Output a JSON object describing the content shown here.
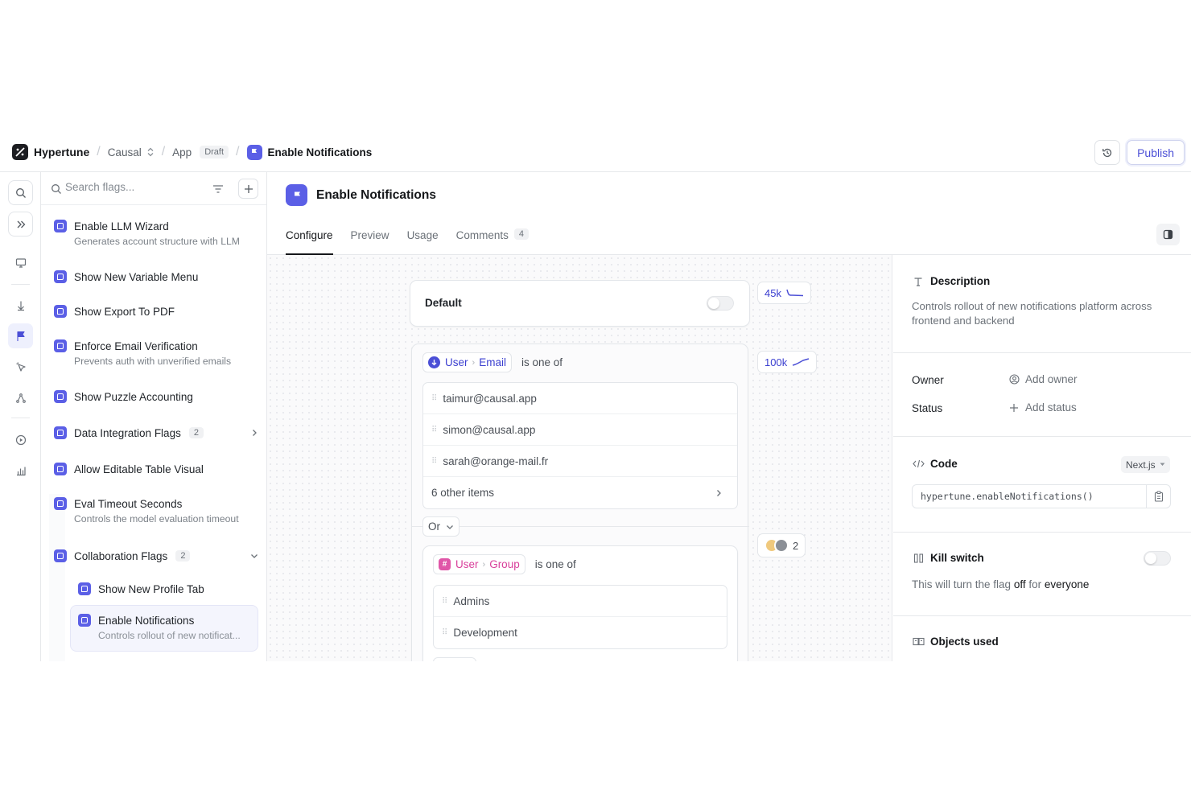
{
  "header": {
    "brand": "Hypertune",
    "project": "Causal",
    "app": "App",
    "app_status": "Draft",
    "flag_title": "Enable Notifications",
    "publish_label": "Publish"
  },
  "sidebar": {
    "search_placeholder": "Search flags...",
    "items": [
      {
        "title": "Enable LLM Wizard",
        "desc": "Generates account structure with LLM"
      },
      {
        "title": "Show New Variable Menu"
      },
      {
        "title": "Show Export To PDF"
      },
      {
        "title": "Enforce Email Verification",
        "desc": "Prevents auth with unverified emails"
      },
      {
        "title": "Show Puzzle Accounting"
      },
      {
        "title": "Data Integration Flags",
        "count": "2"
      },
      {
        "title": "Allow Editable Table Visual"
      },
      {
        "title": "Eval Timeout Seconds",
        "desc": "Controls the model evaluation timeout"
      },
      {
        "title": "Collaboration Flags",
        "count": "2"
      },
      {
        "title": "Show New Profile Tab"
      },
      {
        "title": "Enable Notifications",
        "desc": "Controls rollout of new notificat..."
      }
    ]
  },
  "main": {
    "title": "Enable Notifications",
    "tabs": [
      {
        "label": "Configure",
        "active": true
      },
      {
        "label": "Preview"
      },
      {
        "label": "Usage"
      },
      {
        "label": "Comments",
        "count": "4"
      }
    ]
  },
  "canvas": {
    "default_label": "Default",
    "default_count": "45k",
    "rule1": {
      "chip_a": "User",
      "chip_b": "Email",
      "operator": "is one of",
      "count": "100k",
      "items": [
        "taimur@causal.app",
        "simon@causal.app",
        "sarah@orange-mail.fr"
      ],
      "more": "6 other items"
    },
    "or_label": "Or",
    "rule2": {
      "chip_a": "User",
      "chip_b": "Group",
      "operator": "is one of",
      "avatar_count": "2",
      "items": [
        "Admins",
        "Development"
      ]
    }
  },
  "details": {
    "description_title": "Description",
    "description_text": "Controls rollout of new notifications platform across frontend and backend",
    "owner_label": "Owner",
    "owner_action": "Add owner",
    "status_label": "Status",
    "status_action": "Add status",
    "code_title": "Code",
    "code_framework": "Next.js",
    "code_snippet": "hypertune.enableNotifications()",
    "kill_title": "Kill switch",
    "kill_text_a": "This will turn the flag ",
    "kill_text_b": "off",
    "kill_text_c": " for ",
    "kill_text_d": "everyone",
    "objects_title": "Objects used"
  },
  "colors": {
    "accent": "#5b5fe6",
    "link": "#3b3fd0",
    "group": "#d9409b"
  }
}
